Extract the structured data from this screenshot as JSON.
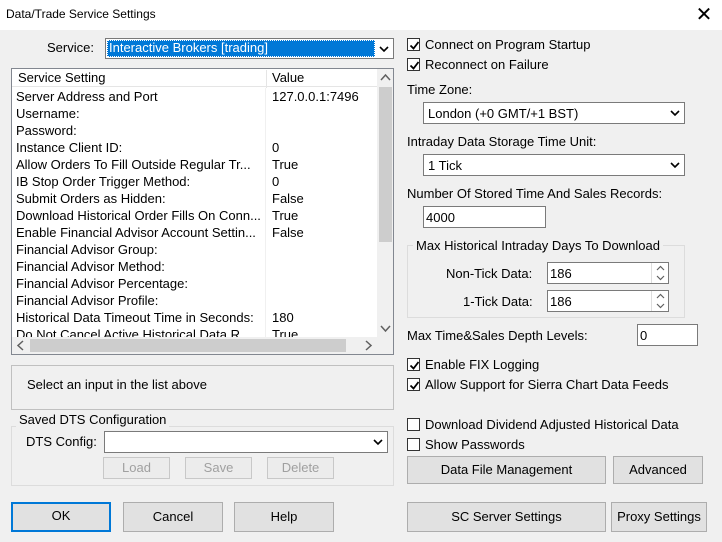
{
  "window": {
    "title": "Data/Trade Service Settings"
  },
  "service": {
    "label": "Service:",
    "value": "Interactive Brokers    [trading]"
  },
  "settings_list": {
    "headers": [
      "Service Setting",
      "Value"
    ],
    "rows": [
      {
        "setting": "Server Address and Port",
        "value": "127.0.0.1:7496"
      },
      {
        "setting": "Username:",
        "value": ""
      },
      {
        "setting": "Password:",
        "value": ""
      },
      {
        "setting": "Instance Client ID:",
        "value": "0"
      },
      {
        "setting": "Allow Orders To Fill Outside Regular Tr...",
        "value": "True"
      },
      {
        "setting": "IB Stop Order Trigger Method:",
        "value": "0"
      },
      {
        "setting": "Submit Orders as Hidden:",
        "value": "False"
      },
      {
        "setting": "Download Historical Order Fills On Conn...",
        "value": "True"
      },
      {
        "setting": "Enable Financial Advisor Account Settin...",
        "value": "False"
      },
      {
        "setting": "Financial Advisor Group:",
        "value": ""
      },
      {
        "setting": "Financial Advisor Method:",
        "value": ""
      },
      {
        "setting": "Financial Advisor Percentage:",
        "value": ""
      },
      {
        "setting": "Financial Advisor Profile:",
        "value": ""
      },
      {
        "setting": "Historical Data Timeout Time in Seconds:",
        "value": "180"
      },
      {
        "setting": "Do Not Cancel Active Historical Data R...",
        "value": "True"
      }
    ]
  },
  "status_text": "Select an input in the list above",
  "saved_dts": {
    "group_title": "Saved DTS Configuration",
    "config_label": "DTS Config:",
    "config_value": "",
    "load_label": "Load",
    "save_label": "Save",
    "delete_label": "Delete"
  },
  "bottom_buttons": {
    "ok": "OK",
    "cancel": "Cancel",
    "help": "Help"
  },
  "right": {
    "connect_startup": {
      "label": "Connect on Program Startup",
      "checked": true
    },
    "reconnect_failure": {
      "label": "Reconnect on Failure",
      "checked": true
    },
    "timezone_label": "Time Zone:",
    "timezone_value": "London (+0 GMT/+1 BST)",
    "storage_unit_label": "Intraday Data Storage Time Unit:",
    "storage_unit_value": "1 Tick",
    "stored_records_label": "Number Of Stored Time And Sales Records:",
    "stored_records_value": "4000",
    "max_days_group": "Max Historical Intraday Days To Download",
    "non_tick_label": "Non-Tick Data:",
    "non_tick_value": "186",
    "one_tick_label": "1-Tick Data:",
    "one_tick_value": "186",
    "depth_label": "Max Time&Sales Depth Levels:",
    "depth_value": "0",
    "fix_logging": {
      "label": "Enable FIX Logging",
      "checked": true
    },
    "sierra_feeds": {
      "label": "Allow Support for Sierra Chart Data Feeds",
      "checked": true
    },
    "dividend_adjusted": {
      "label": "Download Dividend Adjusted Historical Data",
      "checked": false
    },
    "show_passwords": {
      "label": "Show Passwords",
      "checked": false
    },
    "data_file_mgmt": "Data File Management",
    "advanced": "Advanced",
    "sc_server": "SC Server Settings",
    "proxy": "Proxy Settings"
  }
}
